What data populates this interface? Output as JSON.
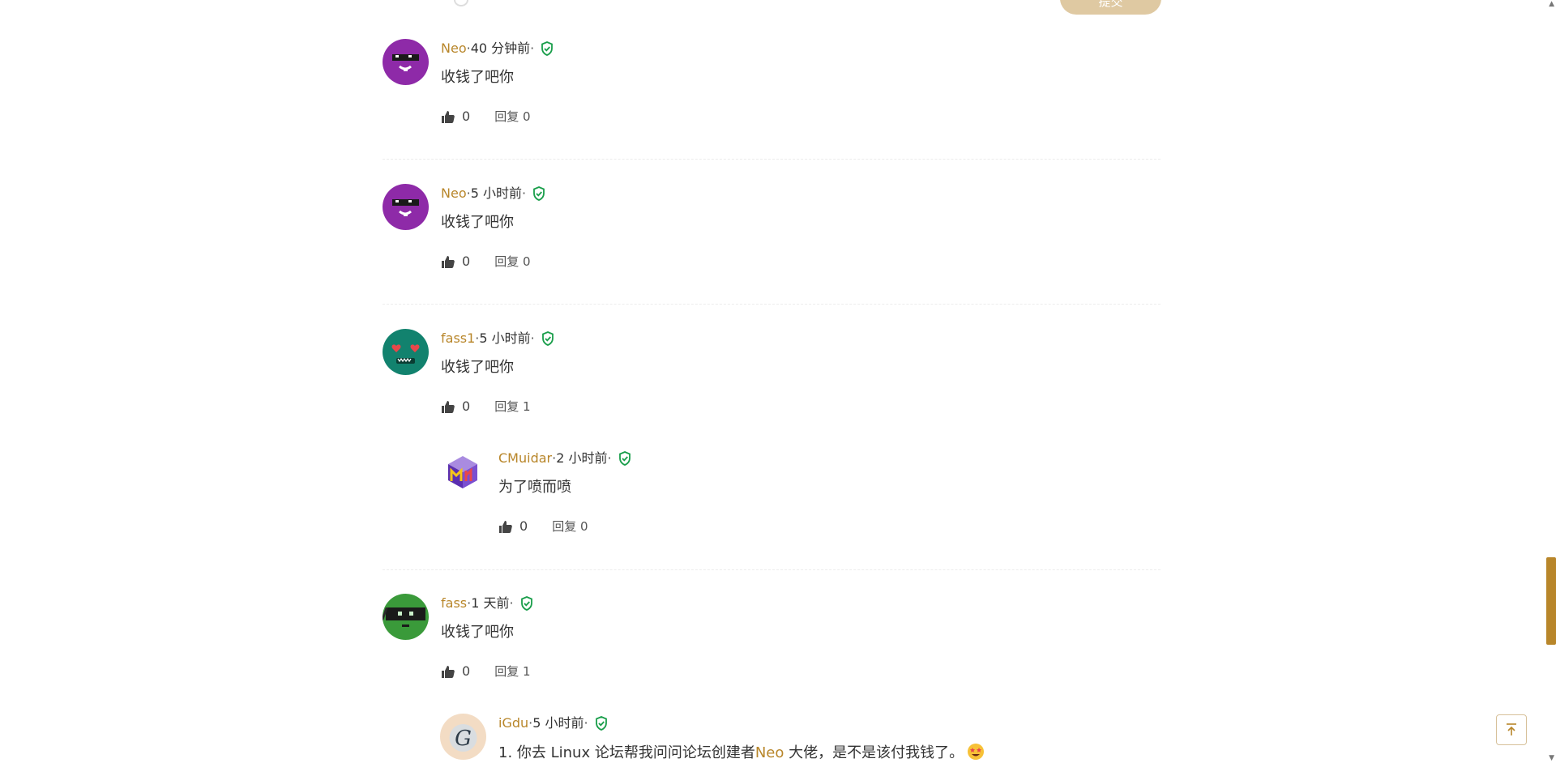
{
  "form": {
    "submit_label": "提交"
  },
  "comments": [
    {
      "user": "Neo",
      "time": "40 分钟前",
      "body": "收钱了吧你",
      "likes": "0",
      "reply_label": "回复 0",
      "avatar": "purple-sunglasses-avatar"
    },
    {
      "user": "Neo",
      "time": "5 小时前",
      "body": "收钱了吧你",
      "likes": "0",
      "reply_label": "回复 0",
      "avatar": "purple-sunglasses-avatar"
    },
    {
      "user": "fass1",
      "time": "5 小时前",
      "body": "收钱了吧你",
      "likes": "0",
      "reply_label": "回复 1",
      "avatar": "teal-heart-eyes-avatar",
      "replies": [
        {
          "user": "CMuidar",
          "time": "2 小时前",
          "body": "为了喷而喷",
          "likes": "0",
          "reply_label": "回复 0",
          "avatar": "purple-cube-avatar"
        }
      ]
    },
    {
      "user": "fass",
      "time": "1 天前",
      "body": "收钱了吧你",
      "likes": "0",
      "reply_label": "回复 1",
      "avatar": "green-ninja-avatar",
      "replies": [
        {
          "user": "iGdu",
          "time": "5 小时前",
          "body_pre": "1. 你去 Linux 论坛帮我问问论坛创建者",
          "mention": "Neo",
          "body_post": " 大佬，是不是该付我钱了。",
          "emoji": "star-struck-emoji",
          "avatar": "letter-g-avatar"
        }
      ]
    }
  ],
  "meta_separator": " · ",
  "colors": {
    "accent": "#b8862a",
    "verified": "#1a9e4b",
    "button_bg": "#dfc9a2"
  },
  "icons": {
    "verified": "shield-check-icon",
    "like": "thumbs-up-icon",
    "back_to_top": "arrow-up-to-line-icon"
  }
}
